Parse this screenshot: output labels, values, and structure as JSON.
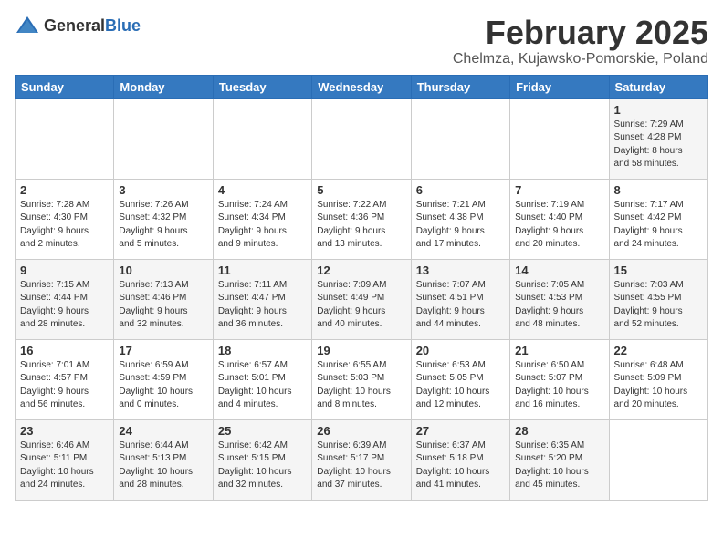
{
  "header": {
    "logo_general": "General",
    "logo_blue": "Blue",
    "month": "February 2025",
    "location": "Chelmza, Kujawsko-Pomorskie, Poland"
  },
  "weekdays": [
    "Sunday",
    "Monday",
    "Tuesday",
    "Wednesday",
    "Thursday",
    "Friday",
    "Saturday"
  ],
  "weeks": [
    [
      {
        "day": "",
        "info": ""
      },
      {
        "day": "",
        "info": ""
      },
      {
        "day": "",
        "info": ""
      },
      {
        "day": "",
        "info": ""
      },
      {
        "day": "",
        "info": ""
      },
      {
        "day": "",
        "info": ""
      },
      {
        "day": "1",
        "info": "Sunrise: 7:29 AM\nSunset: 4:28 PM\nDaylight: 8 hours\nand 58 minutes."
      }
    ],
    [
      {
        "day": "2",
        "info": "Sunrise: 7:28 AM\nSunset: 4:30 PM\nDaylight: 9 hours\nand 2 minutes."
      },
      {
        "day": "3",
        "info": "Sunrise: 7:26 AM\nSunset: 4:32 PM\nDaylight: 9 hours\nand 5 minutes."
      },
      {
        "day": "4",
        "info": "Sunrise: 7:24 AM\nSunset: 4:34 PM\nDaylight: 9 hours\nand 9 minutes."
      },
      {
        "day": "5",
        "info": "Sunrise: 7:22 AM\nSunset: 4:36 PM\nDaylight: 9 hours\nand 13 minutes."
      },
      {
        "day": "6",
        "info": "Sunrise: 7:21 AM\nSunset: 4:38 PM\nDaylight: 9 hours\nand 17 minutes."
      },
      {
        "day": "7",
        "info": "Sunrise: 7:19 AM\nSunset: 4:40 PM\nDaylight: 9 hours\nand 20 minutes."
      },
      {
        "day": "8",
        "info": "Sunrise: 7:17 AM\nSunset: 4:42 PM\nDaylight: 9 hours\nand 24 minutes."
      }
    ],
    [
      {
        "day": "9",
        "info": "Sunrise: 7:15 AM\nSunset: 4:44 PM\nDaylight: 9 hours\nand 28 minutes."
      },
      {
        "day": "10",
        "info": "Sunrise: 7:13 AM\nSunset: 4:46 PM\nDaylight: 9 hours\nand 32 minutes."
      },
      {
        "day": "11",
        "info": "Sunrise: 7:11 AM\nSunset: 4:47 PM\nDaylight: 9 hours\nand 36 minutes."
      },
      {
        "day": "12",
        "info": "Sunrise: 7:09 AM\nSunset: 4:49 PM\nDaylight: 9 hours\nand 40 minutes."
      },
      {
        "day": "13",
        "info": "Sunrise: 7:07 AM\nSunset: 4:51 PM\nDaylight: 9 hours\nand 44 minutes."
      },
      {
        "day": "14",
        "info": "Sunrise: 7:05 AM\nSunset: 4:53 PM\nDaylight: 9 hours\nand 48 minutes."
      },
      {
        "day": "15",
        "info": "Sunrise: 7:03 AM\nSunset: 4:55 PM\nDaylight: 9 hours\nand 52 minutes."
      }
    ],
    [
      {
        "day": "16",
        "info": "Sunrise: 7:01 AM\nSunset: 4:57 PM\nDaylight: 9 hours\nand 56 minutes."
      },
      {
        "day": "17",
        "info": "Sunrise: 6:59 AM\nSunset: 4:59 PM\nDaylight: 10 hours\nand 0 minutes."
      },
      {
        "day": "18",
        "info": "Sunrise: 6:57 AM\nSunset: 5:01 PM\nDaylight: 10 hours\nand 4 minutes."
      },
      {
        "day": "19",
        "info": "Sunrise: 6:55 AM\nSunset: 5:03 PM\nDaylight: 10 hours\nand 8 minutes."
      },
      {
        "day": "20",
        "info": "Sunrise: 6:53 AM\nSunset: 5:05 PM\nDaylight: 10 hours\nand 12 minutes."
      },
      {
        "day": "21",
        "info": "Sunrise: 6:50 AM\nSunset: 5:07 PM\nDaylight: 10 hours\nand 16 minutes."
      },
      {
        "day": "22",
        "info": "Sunrise: 6:48 AM\nSunset: 5:09 PM\nDaylight: 10 hours\nand 20 minutes."
      }
    ],
    [
      {
        "day": "23",
        "info": "Sunrise: 6:46 AM\nSunset: 5:11 PM\nDaylight: 10 hours\nand 24 minutes."
      },
      {
        "day": "24",
        "info": "Sunrise: 6:44 AM\nSunset: 5:13 PM\nDaylight: 10 hours\nand 28 minutes."
      },
      {
        "day": "25",
        "info": "Sunrise: 6:42 AM\nSunset: 5:15 PM\nDaylight: 10 hours\nand 32 minutes."
      },
      {
        "day": "26",
        "info": "Sunrise: 6:39 AM\nSunset: 5:17 PM\nDaylight: 10 hours\nand 37 minutes."
      },
      {
        "day": "27",
        "info": "Sunrise: 6:37 AM\nSunset: 5:18 PM\nDaylight: 10 hours\nand 41 minutes."
      },
      {
        "day": "28",
        "info": "Sunrise: 6:35 AM\nSunset: 5:20 PM\nDaylight: 10 hours\nand 45 minutes."
      },
      {
        "day": "",
        "info": ""
      }
    ]
  ]
}
